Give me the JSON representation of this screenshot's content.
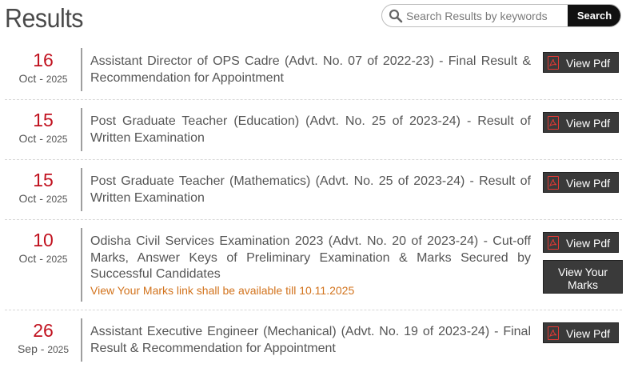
{
  "page": {
    "title": "Results"
  },
  "search": {
    "placeholder": "Search Results by keywords",
    "button_label": "Search"
  },
  "results": [
    {
      "day": "16",
      "month": "Oct",
      "year": "2025",
      "title": "Assistant Director of OPS Cadre (Advt. No. 07 of 2022-23) - Final Result & Recommendation for Appointment",
      "pdf_label": "View Pdf"
    },
    {
      "day": "15",
      "month": "Oct",
      "year": "2025",
      "title": "Post Graduate Teacher (Education) (Advt. No. 25 of 2023-24) - Result of Written Examination",
      "pdf_label": "View Pdf"
    },
    {
      "day": "15",
      "month": "Oct",
      "year": "2025",
      "title": "Post Graduate Teacher (Mathematics) (Advt. No. 25 of 2023-24) - Result of Written Examination",
      "pdf_label": "View Pdf"
    },
    {
      "day": "10",
      "month": "Oct",
      "year": "2025",
      "title": "Odisha Civil Services Examination 2023 (Advt. No. 20 of 2023-24) - Cut-off Marks, Answer Keys of Preliminary Examination & Marks Secured by Successful Candidates",
      "note": "View Your Marks link shall be available till 10.11.2025",
      "pdf_label": "View Pdf",
      "marks_label": "View Your Marks"
    },
    {
      "day": "26",
      "month": "Sep",
      "year": "2025",
      "title": "Assistant Executive Engineer (Mechanical) (Advt. No. 19 of 2023-24) - Final Result & Recommendation for Appointment",
      "pdf_label": "View Pdf"
    }
  ],
  "colors": {
    "date_accent": "#c1121f",
    "note_text": "#d2731d",
    "button_bg": "#3a3a3a",
    "pdf_icon": "#e53935"
  },
  "icons": {
    "search": "search-icon",
    "pdf": "pdf-file-icon"
  }
}
